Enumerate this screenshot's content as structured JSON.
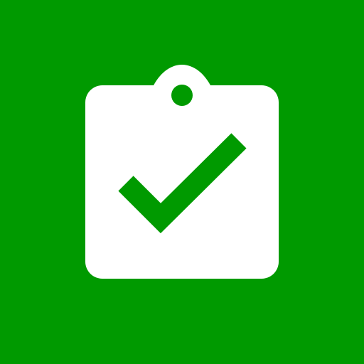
{
  "icon": {
    "name": "clipboard-check-icon",
    "background_color": "#009A00",
    "clipboard_color": "#FFFFFF",
    "check_color": "#009A00"
  }
}
